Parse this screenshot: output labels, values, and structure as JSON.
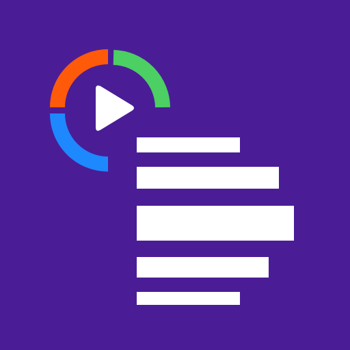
{
  "app_icon": {
    "background_color": "#4a1d96",
    "ring": {
      "segments": [
        {
          "name": "orange-segment",
          "color": "#ff5a0a"
        },
        {
          "name": "green-segment",
          "color": "#4ccf63"
        },
        {
          "name": "blue-segment",
          "color": "#1e88ff"
        }
      ]
    },
    "play_icon": "play-icon",
    "play_color": "#ffffff",
    "bars_color": "#ffffff",
    "bars_count": 5
  }
}
